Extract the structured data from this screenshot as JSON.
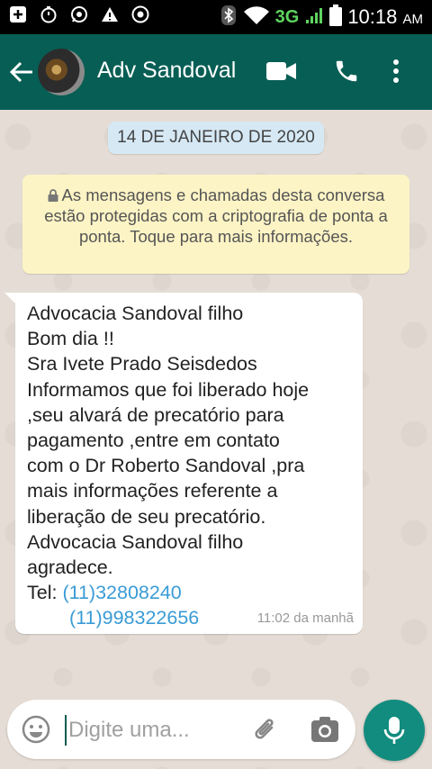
{
  "status_bar": {
    "network": "3G",
    "time": "10:18",
    "ampm": "AM"
  },
  "header": {
    "contact_name": "Adv Sandoval"
  },
  "chat": {
    "date_chip": "14 DE JANEIRO DE 2020",
    "encryption_notice": "As mensagens e chamadas desta conversa estão protegidas com a criptografia de ponta a ponta. Toque para mais informações.",
    "message": {
      "text": "Advocacia Sandoval filho\nBom dia !!\nSra Ivete Prado Seisdedos\nInformamos que foi liberado hoje\n,seu alvará de precatório para\npagamento ,entre em contato\ncom o Dr Roberto Sandoval ,pra\nmais informações referente a\nliberação de seu precatório.\nAdvocacia Sandoval filho\nagradece.",
      "tel_label": "Tel: ",
      "phone1": "(11)32808240",
      "phone2": "(11)998322656",
      "timestamp": "11:02 da manhã"
    }
  },
  "composer": {
    "placeholder": "Digite uma..."
  },
  "colors": {
    "app_bar": "#075e54",
    "fab": "#128c7e",
    "link": "#3a9bd5",
    "date_chip": "#d5e8f4",
    "notice": "#fdf4c5"
  }
}
